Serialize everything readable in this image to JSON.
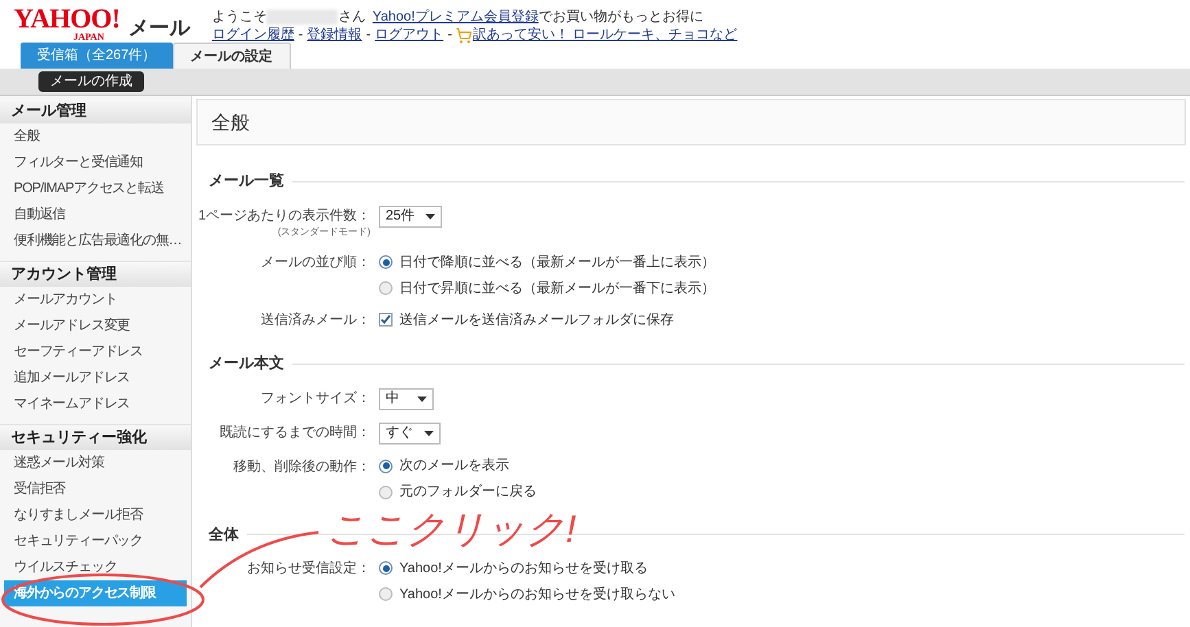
{
  "header": {
    "logo": "YAHOO!",
    "logo_sub": "JAPAN",
    "service": "メール",
    "greeting_prefix": "ようこそ",
    "greeting_suffix": "さん",
    "premium_link": "Yahoo!プレミアム会員登録",
    "premium_text": "でお買い物がもっとお得に",
    "links": [
      {
        "kind": "link",
        "text": "ログイン履歴"
      },
      {
        "kind": "sep",
        "text": "-"
      },
      {
        "kind": "link",
        "text": "登録情報"
      },
      {
        "kind": "sep",
        "text": "-"
      },
      {
        "kind": "link",
        "text": "ログアウト"
      },
      {
        "kind": "sep",
        "text": "-"
      },
      {
        "kind": "promo",
        "text": "訳あって安い！ ロールケーキ、チョコなど"
      }
    ]
  },
  "tabs": [
    {
      "label": "受信箱（全267件）",
      "selected": false
    },
    {
      "label": "メールの設定",
      "selected": true
    }
  ],
  "compose_button": "メールの作成",
  "sidebar": [
    {
      "title": "メール管理",
      "items": [
        {
          "label": "全般",
          "selected": false
        },
        {
          "label": "フィルターと受信通知",
          "selected": false
        },
        {
          "label": "POP/IMAPアクセスと転送",
          "selected": false
        },
        {
          "label": "自動返信",
          "selected": false
        },
        {
          "label": "便利機能と広告最適化の無…",
          "selected": false
        }
      ]
    },
    {
      "title": "アカウント管理",
      "items": [
        {
          "label": "メールアカウント",
          "selected": false
        },
        {
          "label": "メールアドレス変更",
          "selected": false
        },
        {
          "label": "セーフティーアドレス",
          "selected": false
        },
        {
          "label": "追加メールアドレス",
          "selected": false
        },
        {
          "label": "マイネームアドレス",
          "selected": false
        }
      ]
    },
    {
      "title": "セキュリティー強化",
      "items": [
        {
          "label": "迷惑メール対策",
          "selected": false
        },
        {
          "label": "受信拒否",
          "selected": false
        },
        {
          "label": "なりすましメール拒否",
          "selected": false
        },
        {
          "label": "セキュリティーパック",
          "selected": false
        },
        {
          "label": "ウイルスチェック",
          "selected": false
        },
        {
          "label": "海外からのアクセス制限",
          "selected": true
        }
      ]
    }
  ],
  "page_title": "全般",
  "sections": [
    {
      "title": "メール一覧",
      "rows": [
        {
          "kind": "select",
          "label": "1ページあたりの表示件数：",
          "sublabel": "(スタンダードモード)",
          "value": "25件"
        },
        {
          "kind": "radio",
          "label": "メールの並び順：",
          "options": [
            {
              "label": "日付で降順に並べる（最新メールが一番上に表示）",
              "selected": true
            },
            {
              "label": "日付で昇順に並べる（最新メールが一番下に表示）",
              "selected": false
            }
          ]
        },
        {
          "kind": "checkbox",
          "label": "送信済みメール：",
          "text": "送信メールを送信済みメールフォルダに保存",
          "checked": true
        }
      ]
    },
    {
      "title": "メール本文",
      "rows": [
        {
          "kind": "select",
          "label": "フォントサイズ：",
          "value": "中"
        },
        {
          "kind": "select",
          "label": "既読にするまでの時間：",
          "value": "すぐ"
        },
        {
          "kind": "radio",
          "label": "移動、削除後の動作：",
          "options": [
            {
              "label": "次のメールを表示",
              "selected": true
            },
            {
              "label": "元のフォルダーに戻る",
              "selected": false
            }
          ]
        }
      ]
    },
    {
      "title": "全体",
      "rows": [
        {
          "kind": "radio",
          "label": "お知らせ受信設定：",
          "options": [
            {
              "label": "Yahoo!メールからのお知らせを受け取る",
              "selected": true
            },
            {
              "label": "Yahoo!メールからのお知らせを受け取らない",
              "selected": false
            }
          ]
        }
      ]
    }
  ],
  "annotation": "ここクリック!"
}
